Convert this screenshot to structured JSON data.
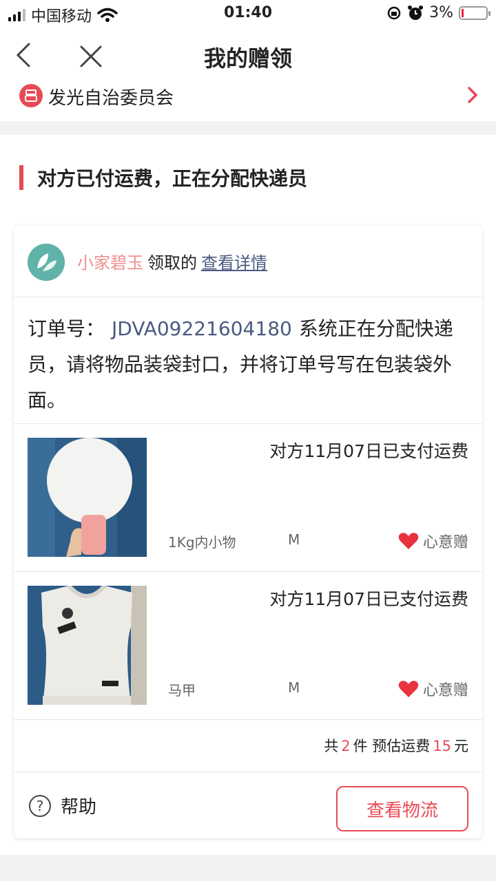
{
  "status_bar": {
    "carrier": "中国移动",
    "time": "01:40",
    "battery": "3%"
  },
  "nav": {
    "title": "我的赠领"
  },
  "shop": {
    "name": "发光自治委员会"
  },
  "order_status": {
    "title": "对方已付运费，正在分配快递员"
  },
  "claim": {
    "nickname": "小家碧玉",
    "claimed_text": "领取的",
    "details_link": "查看详情"
  },
  "order": {
    "label": "订单号：",
    "number": "JDVA09221604180",
    "message": "系统正在分配快递员，请将物品装袋封口，并将订单号写在包装袋外面。"
  },
  "items": [
    {
      "paid_text": "对方11月07日已支付运费",
      "category": "1Kg内小物",
      "size": "M",
      "gift_label": "心意赠"
    },
    {
      "paid_text": "对方11月07日已支付运费",
      "category": "马甲",
      "size": "M",
      "gift_label": "心意赠"
    }
  ],
  "summary": {
    "prefix": "共",
    "count": "2",
    "mid": "件 预估运费",
    "fee": "15",
    "unit": "元"
  },
  "footer": {
    "help_label": "帮助",
    "logistics_button": "查看物流"
  },
  "colors": {
    "accent": "#e84a55",
    "link": "#4a5a80",
    "nickname": "#ef8f8f"
  }
}
